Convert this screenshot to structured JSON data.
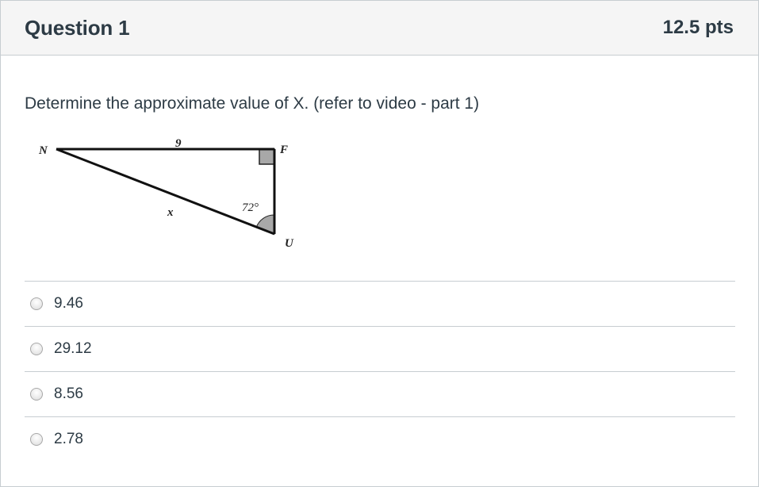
{
  "question": {
    "title": "Question 1",
    "points": "12.5 pts",
    "prompt": "Determine the approximate value of X. (refer to video - part 1)"
  },
  "figure": {
    "vertex_n": "N",
    "vertex_f": "F",
    "vertex_u": "U",
    "side_nf": "9",
    "side_nu": "x",
    "angle_u": "72°"
  },
  "answers": [
    {
      "label": "9.46",
      "selected": false
    },
    {
      "label": "29.12",
      "selected": false
    },
    {
      "label": "8.56",
      "selected": false
    },
    {
      "label": "2.78",
      "selected": false
    }
  ],
  "colors": {
    "text": "#2d3b45",
    "header_bg": "#f5f5f5",
    "border": "#c7cdd1"
  }
}
